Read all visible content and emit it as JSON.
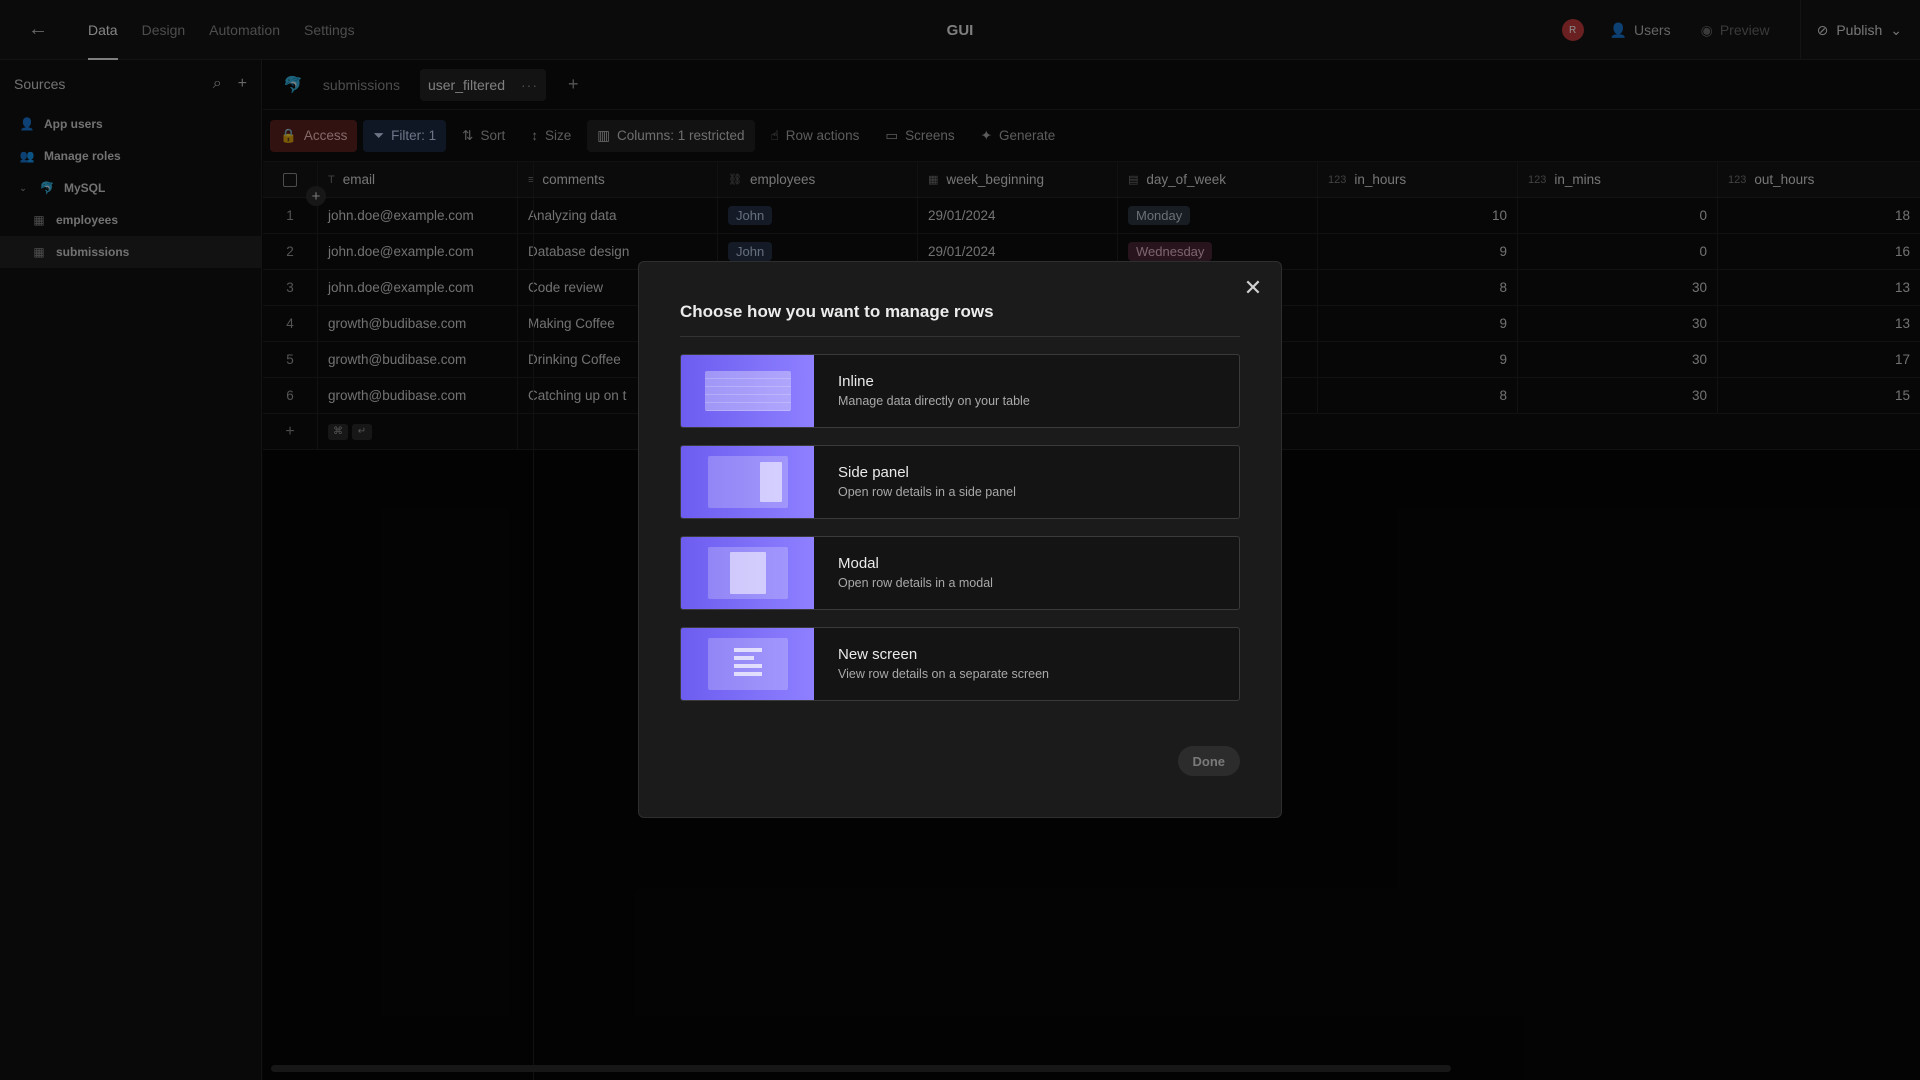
{
  "nav": {
    "tabs": [
      "Data",
      "Design",
      "Automation",
      "Settings"
    ],
    "active_index": 0,
    "app_title": "GUI",
    "avatar_initial": "R",
    "users_label": "Users",
    "preview_label": "Preview",
    "publish_label": "Publish"
  },
  "sidebar": {
    "title": "Sources",
    "items": [
      {
        "label": "App users",
        "icon": "user-icon"
      },
      {
        "label": "Manage roles",
        "icon": "roles-icon"
      },
      {
        "label": "MySQL",
        "icon": "database-icon"
      },
      {
        "label": "employees",
        "icon": "table-icon"
      },
      {
        "label": "submissions",
        "icon": "table-icon"
      }
    ]
  },
  "tabs": {
    "source_label": "submissions",
    "active_label": "user_filtered"
  },
  "toolbar": {
    "access": "Access",
    "filter": "Filter: 1",
    "sort": "Sort",
    "size": "Size",
    "columns": "Columns: 1 restricted",
    "row_actions": "Row actions",
    "screens": "Screens",
    "generate": "Generate"
  },
  "table": {
    "columns": [
      {
        "name": "email",
        "type_icon": "T"
      },
      {
        "name": "comments",
        "type_icon": "≡"
      },
      {
        "name": "employees",
        "type_icon": "⛓"
      },
      {
        "name": "week_beginning",
        "type_icon": "▦"
      },
      {
        "name": "day_of_week",
        "type_icon": "▤"
      },
      {
        "name": "in_hours",
        "type_icon": "123"
      },
      {
        "name": "in_mins",
        "type_icon": "123"
      },
      {
        "name": "out_hours",
        "type_icon": "123"
      }
    ],
    "rows": [
      {
        "n": "1",
        "email": "john.doe@example.com",
        "comments": "Analyzing data",
        "employees": "John",
        "week": "29/01/2024",
        "day": "Monday",
        "in_hours": "10",
        "in_mins": "0",
        "out_hours": "18"
      },
      {
        "n": "2",
        "email": "john.doe@example.com",
        "comments": "Database design",
        "employees": "John",
        "week": "29/01/2024",
        "day": "Wednesday",
        "in_hours": "9",
        "in_mins": "0",
        "out_hours": "16"
      },
      {
        "n": "3",
        "email": "john.doe@example.com",
        "comments": "Code review",
        "employees": "",
        "week": "",
        "day": "",
        "in_hours": "8",
        "in_mins": "30",
        "out_hours": "13"
      },
      {
        "n": "4",
        "email": "growth@budibase.com",
        "comments": "Making Coffee",
        "employees": "",
        "week": "",
        "day": "",
        "in_hours": "9",
        "in_mins": "30",
        "out_hours": "13"
      },
      {
        "n": "5",
        "email": "growth@budibase.com",
        "comments": "Drinking Coffee",
        "employees": "",
        "week": "",
        "day": "",
        "in_hours": "9",
        "in_mins": "30",
        "out_hours": "17"
      },
      {
        "n": "6",
        "email": "growth@budibase.com",
        "comments": "Catching up on t",
        "employees": "",
        "week": "",
        "day": "",
        "in_hours": "8",
        "in_mins": "30",
        "out_hours": "15"
      }
    ]
  },
  "modal": {
    "title": "Choose how you want to manage rows",
    "options": [
      {
        "title": "Inline",
        "desc": "Manage data directly on your table"
      },
      {
        "title": "Side panel",
        "desc": "Open row details in a side panel"
      },
      {
        "title": "Modal",
        "desc": "Open row details in a modal"
      },
      {
        "title": "New screen",
        "desc": "View row details on a separate screen"
      }
    ],
    "done": "Done"
  }
}
